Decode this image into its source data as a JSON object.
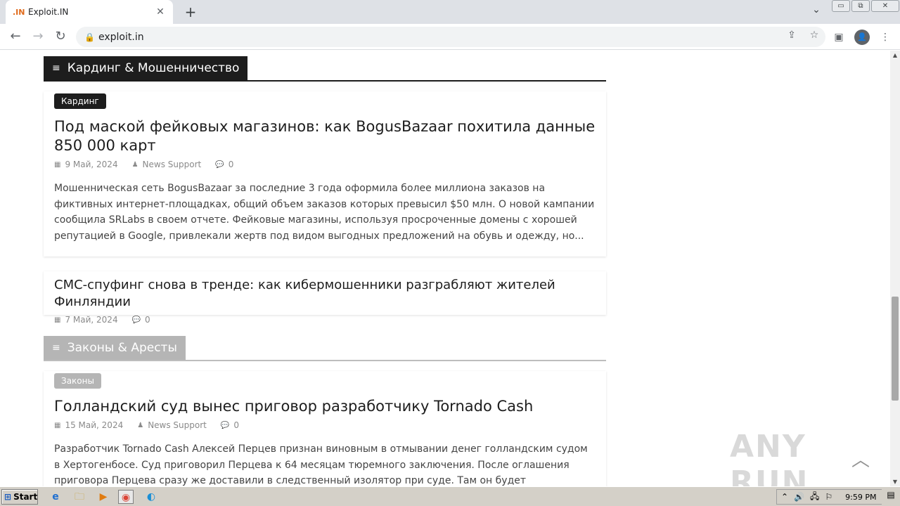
{
  "browser": {
    "tab": {
      "favicon_text": ".IN",
      "title": "Exploit.IN",
      "close_glyph": "✕"
    },
    "new_tab_glyph": "+",
    "tab_dropdown_glyph": "⌄",
    "window_buttons": {
      "minimize": "▭",
      "restore": "⧉",
      "close": "✕"
    },
    "nav": {
      "back": "←",
      "forward": "→",
      "reload": "↻"
    },
    "address": {
      "lock_glyph": "🔒",
      "url": "exploit.in"
    },
    "omnibox_icons": {
      "share": "⇪",
      "bookmark": "☆"
    },
    "toolbar_icons": {
      "side_panel": "▣",
      "profile": "👤",
      "menu": "⋮"
    }
  },
  "sections": [
    {
      "heading": "Кардинг & Мошенничество",
      "heading_icon": "≡",
      "featured": {
        "category": "Кардинг",
        "title": "Под маской фейковых магазинов: как BogusBazaar похитила данные 850 000 карт",
        "date": "9 Май, 2024",
        "author": "News Support",
        "comments": "0",
        "excerpt": "Мошенническая сеть BogusBazaar за последние 3 года оформила более миллиона заказов на фиктивных интернет-площадках, общий объем заказов которых превысил $50 млн. О новой кампании сообщила SRLabs в своем отчете. Фейковые магазины, используя просроченные домены с хорошей репутацией в Google, привлекали жертв под видом выгодных предложений на обувь и одежду, но..."
      },
      "secondary": {
        "title": "СМС-спуфинг снова в тренде: как кибермошенники разграбляют жителей Финляндии",
        "date": "7 Май, 2024",
        "comments": "0"
      }
    },
    {
      "heading": "Законы & Аресты",
      "heading_icon": "≡",
      "featured": {
        "category": "Законы",
        "title": "Голландский суд вынес приговор разработчику Tornado Cash",
        "date": "15 Май, 2024",
        "author": "News Support",
        "comments": "0",
        "excerpt": "Разработчик Tornado Cash Алексей Перцев признан виновным в отмывании денег голландским судом в Хертогенбосе. Суд приговорил Перцева к 64 месяцам тюремного заключения. После оглашения приговора Перцева сразу же доставили в следственный изолятор при суде. Там он будет содержаться до перевода в"
      }
    }
  ],
  "meta_icons": {
    "calendar": "▦",
    "user": "♟",
    "comment": "💬"
  },
  "watermark": "ANY RUN",
  "scroll_to_top_glyph": "︿",
  "taskbar": {
    "start_label": "Start",
    "start_icon": "⊞",
    "apps": [
      {
        "name": "ie",
        "glyph": "e"
      },
      {
        "name": "explorer",
        "glyph": "🗀"
      },
      {
        "name": "media",
        "glyph": "▶"
      },
      {
        "name": "chrome",
        "glyph": "◉"
      },
      {
        "name": "edge",
        "glyph": "◐"
      }
    ],
    "tray_icons": {
      "arrow": "⌃",
      "volume": "🔊",
      "network": "🖧",
      "flag": "⚐"
    },
    "clock": "9:59 PM",
    "show_desktop_glyph": "▤"
  },
  "colors": {
    "section_dark": "#1d1d1d",
    "section_gray": "#b5b5b5",
    "tab_favicon": "#e06a1b"
  }
}
